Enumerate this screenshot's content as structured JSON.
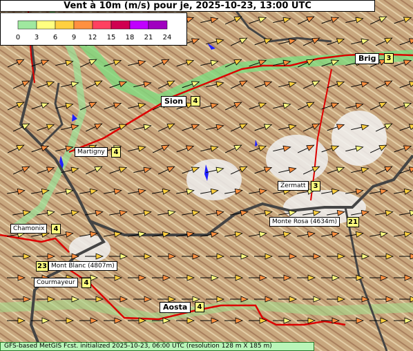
{
  "title": "Vent à 10m (m/s) pour je, 2025-10-23, 13:00 UTC",
  "legend": {
    "ticks": [
      "0",
      "3",
      "6",
      "9",
      "12",
      "15",
      "18",
      "21",
      "24"
    ],
    "colors": [
      "#9fe89f",
      "#ffff80",
      "#ffd040",
      "#ff9040",
      "#ff4060",
      "#d00050",
      "#c000ff",
      "#a000c0"
    ]
  },
  "places": [
    {
      "name": "Brig",
      "value": "3"
    },
    {
      "name": "Sion",
      "value": "4"
    },
    {
      "name": "Martigny",
      "value": "4"
    },
    {
      "name": "Zermatt",
      "value": "3"
    },
    {
      "name": "Chamonix",
      "value": "4"
    },
    {
      "name": "Monte Rosa (4634m)",
      "value": "21"
    },
    {
      "name": "Mont Blanc (4807m)",
      "value": "23"
    },
    {
      "name": "Courmayeur",
      "value": "4"
    },
    {
      "name": "Aosta",
      "value": "4"
    }
  ],
  "footer": "GFS-based MetGIS Fcst. initialized 2025-10-23, 06:00 UTC  (resolution 128 m X 185 m)"
}
